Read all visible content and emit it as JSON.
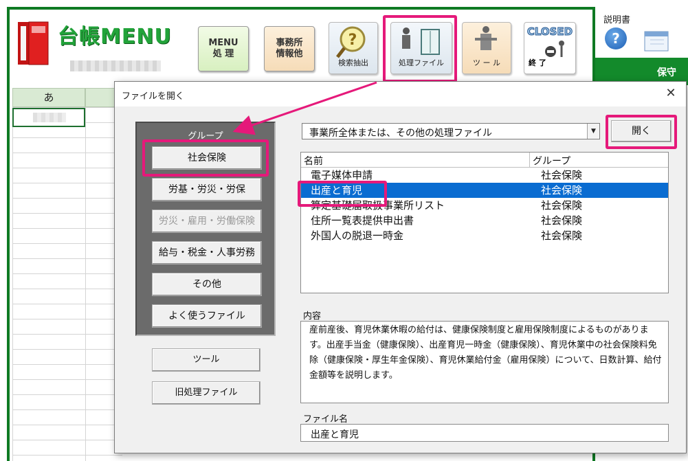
{
  "app": {
    "title": "台帳MENU",
    "help_label": "説明書",
    "side_banner": "保守",
    "column_header": "あ"
  },
  "toolbar": {
    "menu_btn": "MENU\n処 理",
    "office_btn": "事務所\n情報他",
    "search_btn": "検索抽出",
    "process_file_btn": "処理ファイル",
    "tool_btn": "ツ ー ル",
    "closed_btn_top": "CLOSED",
    "closed_btn_bottom": "終 了"
  },
  "dialog": {
    "title": "ファイルを開く",
    "close": "✕",
    "group_label": "グループ",
    "group_buttons": [
      {
        "label": "社会保険",
        "enabled": true
      },
      {
        "label": "労基・労災・労保",
        "enabled": true
      },
      {
        "label": "労災・雇用・労働保険",
        "enabled": false
      },
      {
        "label": "給与・税金・人事労務",
        "enabled": true
      },
      {
        "label": "その他",
        "enabled": true
      },
      {
        "label": "よく使うファイル",
        "enabled": true
      }
    ],
    "tool_button": "ツール",
    "old_files_button": "旧処理ファイル",
    "combo_value": "事業所全体または、その他の処理ファイル",
    "open_button": "開く",
    "list_header": {
      "name": "名前",
      "group": "グループ"
    },
    "list_rows": [
      {
        "name": "電子媒体申請",
        "group": "社会保険",
        "selected": false
      },
      {
        "name": "出産と育児",
        "group": "社会保険",
        "selected": true
      },
      {
        "name": "算定基礎届取扱事業所リスト",
        "group": "社会保険",
        "selected": false
      },
      {
        "name": "住所一覧表提供申出書",
        "group": "社会保険",
        "selected": false
      },
      {
        "name": "外国人の脱退一時金",
        "group": "社会保険",
        "selected": false
      }
    ],
    "description_label": "内容",
    "description": "産前産後、育児休業休暇の給付は、健康保険制度と雇用保険制度によるものがあります。出産手当金（健康保険）、出産育児一時金（健康保険）、育児休業中の社会保険料免除（健康保険・厚生年金保険）、育児休業給付金（雇用保険）について、日数計算、給付金額等を説明します。",
    "filename_label": "ファイル名",
    "filename_value": "出産と育児"
  },
  "colors": {
    "accent_highlight": "#e5197a",
    "excel_green": "#0e7a23",
    "selection_blue": "#0a6cd1"
  }
}
